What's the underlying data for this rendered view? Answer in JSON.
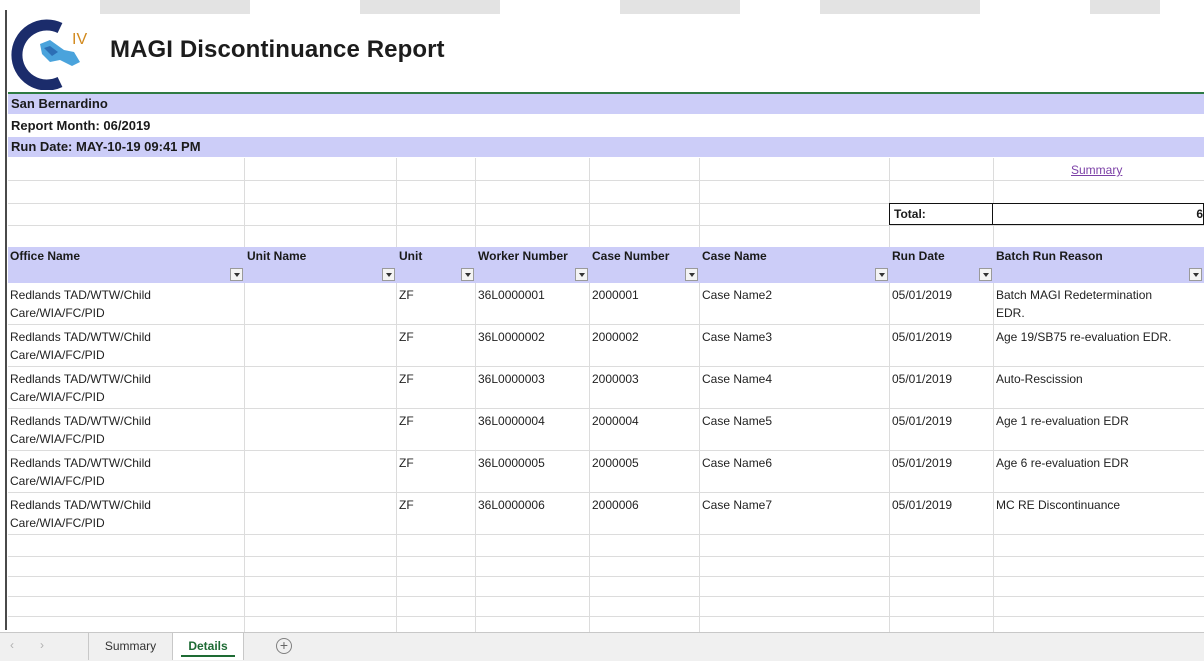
{
  "report": {
    "title": "MAGI Discontinuance Report",
    "logo_icon": "civ-logo-icon",
    "logo_text": "IV",
    "county": "San Bernardino",
    "report_month": "Report Month: 06/2019",
    "run_date": "Run Date: MAY-10-19 09:41 PM"
  },
  "summary_link": "Summary",
  "total": {
    "label": "Total:",
    "value": "6"
  },
  "columns": [
    "Office Name",
    "Unit Name",
    "Unit",
    "Worker Number",
    "Case Number",
    "Case Name",
    "Run Date",
    "Batch Run Reason"
  ],
  "rows": [
    {
      "office_line1": "Redlands TAD/WTW/Child",
      "office_line2": "Care/WIA/FC/PID",
      "unit_name": "",
      "unit": "ZF",
      "worker": "36L0000001",
      "case_number": "2000001",
      "case_name": "Case Name2",
      "run_date": "05/01/2019",
      "reason_line1": "Batch MAGI Redetermination",
      "reason_line2": "EDR."
    },
    {
      "office_line1": "Redlands TAD/WTW/Child",
      "office_line2": "Care/WIA/FC/PID",
      "unit_name": "",
      "unit": "ZF",
      "worker": "36L0000002",
      "case_number": "2000002",
      "case_name": "Case Name3",
      "run_date": "05/01/2019",
      "reason_line1": "Age 19/SB75 re-evaluation EDR.",
      "reason_line2": ""
    },
    {
      "office_line1": "Redlands TAD/WTW/Child",
      "office_line2": "Care/WIA/FC/PID",
      "unit_name": "",
      "unit": "ZF",
      "worker": "36L0000003",
      "case_number": "2000003",
      "case_name": "Case Name4",
      "run_date": "05/01/2019",
      "reason_line1": "Auto-Rescission",
      "reason_line2": ""
    },
    {
      "office_line1": "Redlands TAD/WTW/Child",
      "office_line2": "Care/WIA/FC/PID",
      "unit_name": "",
      "unit": "ZF",
      "worker": "36L0000004",
      "case_number": "2000004",
      "case_name": "Case Name5",
      "run_date": "05/01/2019",
      "reason_line1": "Age 1 re-evaluation EDR",
      "reason_line2": ""
    },
    {
      "office_line1": "Redlands TAD/WTW/Child",
      "office_line2": "Care/WIA/FC/PID",
      "unit_name": "",
      "unit": "ZF",
      "worker": "36L0000005",
      "case_number": "2000005",
      "case_name": "Case Name6",
      "run_date": "05/01/2019",
      "reason_line1": "Age 6 re-evaluation EDR",
      "reason_line2": ""
    },
    {
      "office_line1": "Redlands TAD/WTW/Child",
      "office_line2": "Care/WIA/FC/PID",
      "unit_name": "",
      "unit": "ZF",
      "worker": "36L0000006",
      "case_number": "2000006",
      "case_name": "Case Name7",
      "run_date": "05/01/2019",
      "reason_line1": "MC RE Discontinuance",
      "reason_line2": ""
    }
  ],
  "sheet_tabs": [
    {
      "label": "Summary",
      "active": false
    },
    {
      "label": "Details",
      "active": true
    }
  ],
  "icons": {
    "prev_sheet": "‹",
    "next_sheet": "›",
    "add_sheet": "+",
    "filter": "filter-dropdown-icon"
  },
  "colors": {
    "header_band": "#cccdf8",
    "accent_green": "#1e6b34",
    "link_purple": "#7b3fa6"
  }
}
